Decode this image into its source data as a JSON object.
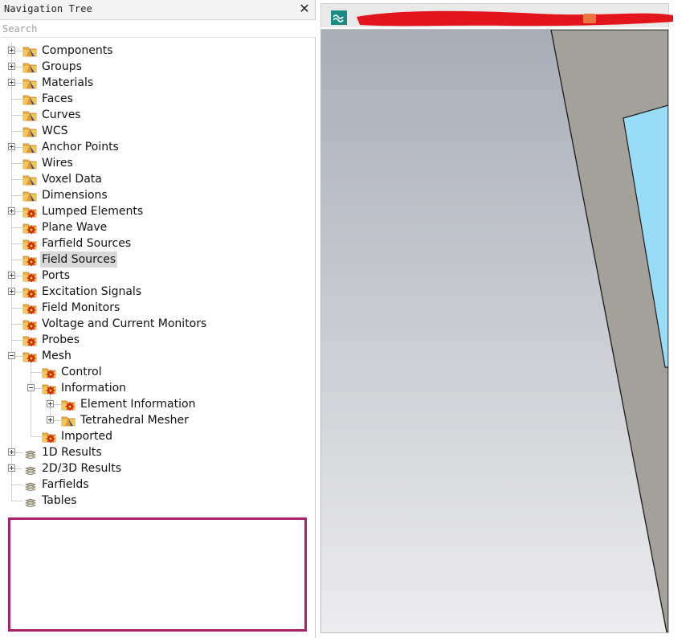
{
  "navigation_tree": {
    "title": "Navigation Tree",
    "close_symbol": "✕",
    "search_placeholder": "Search",
    "items": [
      {
        "label": "Components",
        "icon": "folder-geometry-icon",
        "expander": "plus",
        "level": 0
      },
      {
        "label": "Groups",
        "icon": "folder-geometry-icon",
        "expander": "plus",
        "level": 0
      },
      {
        "label": "Materials",
        "icon": "folder-geometry-icon",
        "expander": "plus",
        "level": 0
      },
      {
        "label": "Faces",
        "icon": "folder-geometry-icon",
        "expander": "none",
        "level": 0
      },
      {
        "label": "Curves",
        "icon": "folder-geometry-icon",
        "expander": "none",
        "level": 0
      },
      {
        "label": "WCS",
        "icon": "folder-geometry-icon",
        "expander": "none",
        "level": 0
      },
      {
        "label": "Anchor Points",
        "icon": "folder-geometry-icon",
        "expander": "plus",
        "level": 0
      },
      {
        "label": "Wires",
        "icon": "folder-geometry-icon",
        "expander": "none",
        "level": 0
      },
      {
        "label": "Voxel Data",
        "icon": "folder-geometry-icon",
        "expander": "none",
        "level": 0
      },
      {
        "label": "Dimensions",
        "icon": "folder-geometry-icon",
        "expander": "none",
        "level": 0
      },
      {
        "label": "Lumped Elements",
        "icon": "folder-gear-icon",
        "expander": "plus",
        "level": 0
      },
      {
        "label": "Plane Wave",
        "icon": "folder-gear-icon",
        "expander": "none",
        "level": 0
      },
      {
        "label": "Farfield Sources",
        "icon": "folder-gear-icon",
        "expander": "none",
        "level": 0
      },
      {
        "label": "Field Sources",
        "icon": "folder-gear-icon",
        "expander": "none",
        "level": 0,
        "selected": true
      },
      {
        "label": "Ports",
        "icon": "folder-gear-icon",
        "expander": "plus",
        "level": 0
      },
      {
        "label": "Excitation Signals",
        "icon": "folder-gear-icon",
        "expander": "plus",
        "level": 0
      },
      {
        "label": "Field Monitors",
        "icon": "folder-gear-icon",
        "expander": "none",
        "level": 0
      },
      {
        "label": "Voltage and Current Monitors",
        "icon": "folder-gear-icon",
        "expander": "none",
        "level": 0
      },
      {
        "label": "Probes",
        "icon": "folder-gear-icon",
        "expander": "none",
        "level": 0
      },
      {
        "label": "Mesh",
        "icon": "folder-gear-icon",
        "expander": "minus",
        "level": 0
      },
      {
        "label": "Control",
        "icon": "folder-gear-icon",
        "expander": "none",
        "level": 1
      },
      {
        "label": "Information",
        "icon": "folder-gear-icon",
        "expander": "minus",
        "level": 1
      },
      {
        "label": "Element Information",
        "icon": "folder-gear-icon",
        "expander": "plus",
        "level": 2
      },
      {
        "label": "Tetrahedral Mesher",
        "icon": "folder-geometry-icon",
        "expander": "plus",
        "level": 2
      },
      {
        "label": "Imported",
        "icon": "folder-gear-icon",
        "expander": "none",
        "level": 1
      },
      {
        "label": "1D Results",
        "icon": "folder-results-icon",
        "expander": "plus",
        "level": 0
      },
      {
        "label": "2D/3D Results",
        "icon": "folder-results-icon",
        "expander": "plus",
        "level": 0
      },
      {
        "label": "Farfields",
        "icon": "folder-results-icon",
        "expander": "none",
        "level": 0
      },
      {
        "label": "Tables",
        "icon": "folder-results-icon",
        "expander": "none",
        "level": 0
      }
    ]
  },
  "viewport": {
    "tab_icon": "cst-wave-icon",
    "tab_label_redacted": true
  },
  "colors": {
    "selection": "#d9d9d9",
    "highlight_box": "#a8226a",
    "redaction": "#e3141b",
    "model_gray": "#a4a19b",
    "model_cyan": "#98dcf8",
    "background_top": "#a8adb7",
    "background_bottom": "#e8e8ea"
  }
}
